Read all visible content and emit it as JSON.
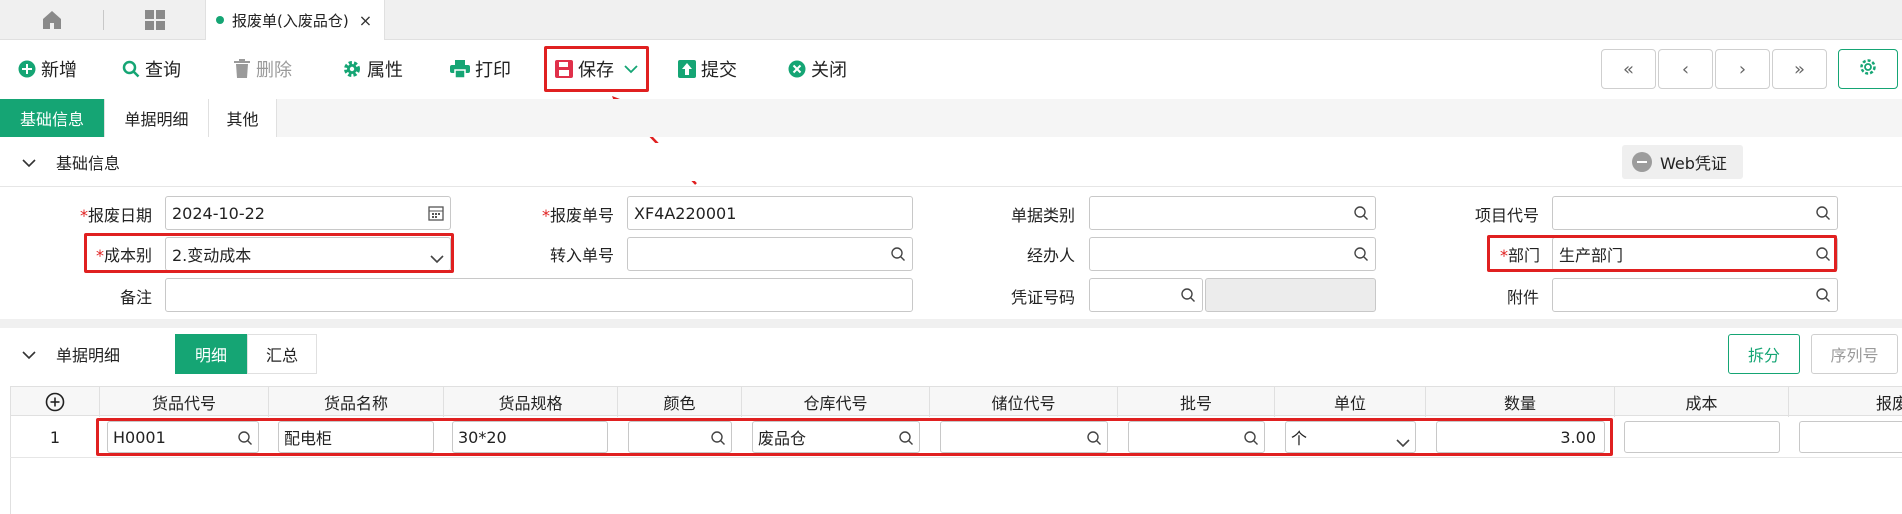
{
  "tabbar": {
    "active_tab": "报废单(入废品仓)",
    "close": "×"
  },
  "toolbar": {
    "new": "新增",
    "query": "查询",
    "delete": "删除",
    "props": "属性",
    "print": "打印",
    "save": "保存",
    "submit": "提交",
    "close": "关闭"
  },
  "nav": {
    "first": "«",
    "prev": "‹",
    "next": "›",
    "last": "»"
  },
  "subtabs": [
    "基础信息",
    "单据明细",
    "其他"
  ],
  "basic": {
    "section_title": "基础信息",
    "web_voucher": "Web凭证",
    "scrap_date_label": "报废日期",
    "scrap_date": "2024-10-22",
    "scrap_no_label": "报废单号",
    "scrap_no": "XF4A220001",
    "doc_type_label": "单据类别",
    "doc_type": "",
    "project_code_label": "项目代号",
    "project_code": "",
    "cost_label": "成本别",
    "cost": "2.变动成本",
    "transfer_no_label": "转入单号",
    "transfer_no": "",
    "handler_label": "经办人",
    "handler": "",
    "dept_label": "部门",
    "dept": "生产部门",
    "remark_label": "备注",
    "remark": "",
    "voucher_no_label": "凭证号码",
    "voucher_no": "",
    "attachment_label": "附件",
    "attachment": ""
  },
  "detail": {
    "section_title": "单据明细",
    "tab_detail": "明细",
    "tab_summary": "汇总",
    "split": "拆分",
    "serial": "序列号",
    "add_icon": "⊕",
    "columns": [
      "货品代号",
      "货品名称",
      "货品规格",
      "颜色",
      "仓库代号",
      "储位代号",
      "批号",
      "单位",
      "数量",
      "成本",
      "报废"
    ],
    "rows": [
      {
        "no": "1",
        "code": "H0001",
        "name": "配电柜",
        "spec": "30*20",
        "color": "",
        "warehouse": "废品仓",
        "location": "",
        "batch": "",
        "unit": "个",
        "qty": "3.00",
        "cost": ""
      }
    ]
  },
  "colors": {
    "accent": "#15a574",
    "highlight": "#e02020"
  }
}
